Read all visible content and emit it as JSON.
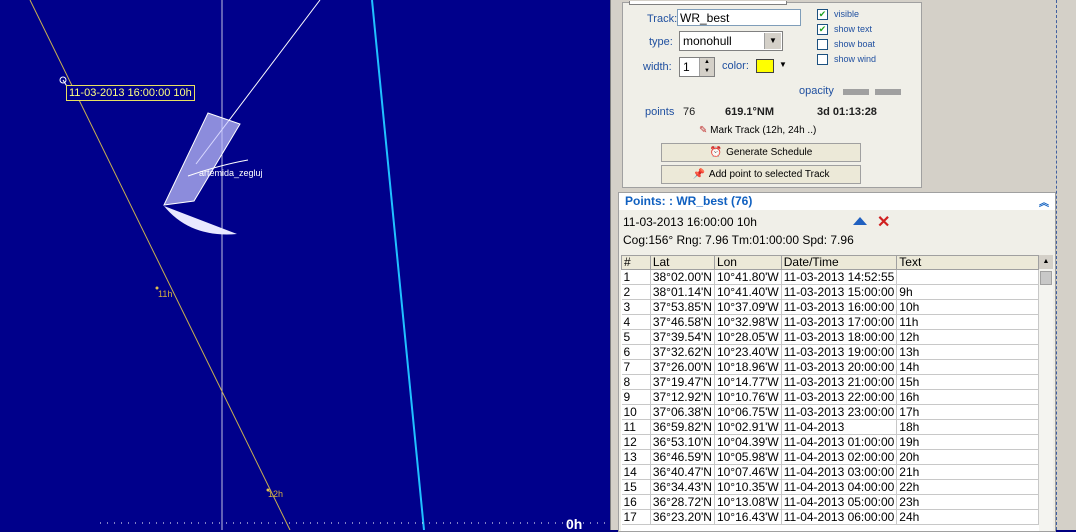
{
  "map": {
    "point_tag": "11-03-2013 16:00:00 10h",
    "boat_name": "artemida_zegluj",
    "hour_labels": [
      "11h",
      "12h"
    ],
    "zero_label": "0h",
    "colors": {
      "sea": "#00008b",
      "track_line": "#c8b050",
      "route_line": "#20c0ff"
    }
  },
  "track_props": {
    "track_label": "Track:",
    "track_value": "WR_best",
    "type_label": "type:",
    "type_value": "monohull",
    "width_label": "width:",
    "width_value": "1",
    "color_label": "color:",
    "color_value": "#ffff00",
    "checkboxes": [
      {
        "label": "visible",
        "checked": true
      },
      {
        "label": "show text",
        "checked": true
      },
      {
        "label": "show boat",
        "checked": false
      },
      {
        "label": "show wind",
        "checked": false
      }
    ],
    "opacity_label": "opacity",
    "points_label": "points",
    "points_value": "76",
    "distance": "619.1°NM",
    "duration": "3d 01:13:28",
    "mark_track_label": "Mark Track (12h, 24h ..)",
    "generate_schedule_label": "Generate Schedule",
    "add_point_label": "Add point to selected Track"
  },
  "points": {
    "header": "Points: : WR_best (76)",
    "selected_time": "11-03-2013 16:00:00 10h",
    "cog_line": "Cog:156° Rng:  7.96 Tm:01:00:00 Spd:  7.96",
    "columns": [
      "#",
      "Lat",
      "Lon",
      "Date/Time",
      "Text"
    ],
    "rows": [
      [
        "1",
        "38°02.00'N",
        "10°41.80'W",
        "11-03-2013 14:52:55",
        ""
      ],
      [
        "2",
        "38°01.14'N",
        "10°41.40'W",
        "11-03-2013 15:00:00",
        "9h"
      ],
      [
        "3",
        "37°53.85'N",
        "10°37.09'W",
        "11-03-2013 16:00:00",
        "10h"
      ],
      [
        "4",
        "37°46.58'N",
        "10°32.98'W",
        "11-03-2013 17:00:00",
        "11h"
      ],
      [
        "5",
        "37°39.54'N",
        "10°28.05'W",
        "11-03-2013 18:00:00",
        "12h"
      ],
      [
        "6",
        "37°32.62'N",
        "10°23.40'W",
        "11-03-2013 19:00:00",
        "13h"
      ],
      [
        "7",
        "37°26.00'N",
        "10°18.96'W",
        "11-03-2013 20:00:00",
        "14h"
      ],
      [
        "8",
        "37°19.47'N",
        "10°14.77'W",
        "11-03-2013 21:00:00",
        "15h"
      ],
      [
        "9",
        "37°12.92'N",
        "10°10.76'W",
        "11-03-2013 22:00:00",
        "16h"
      ],
      [
        "10",
        "37°06.38'N",
        "10°06.75'W",
        "11-03-2013 23:00:00",
        "17h"
      ],
      [
        "11",
        "36°59.82'N",
        "10°02.91'W",
        "11-04-2013",
        "18h"
      ],
      [
        "12",
        "36°53.10'N",
        "10°04.39'W",
        "11-04-2013 01:00:00",
        "19h"
      ],
      [
        "13",
        "36°46.59'N",
        "10°05.98'W",
        "11-04-2013 02:00:00",
        "20h"
      ],
      [
        "14",
        "36°40.47'N",
        "10°07.46'W",
        "11-04-2013 03:00:00",
        "21h"
      ],
      [
        "15",
        "36°34.43'N",
        "10°10.35'W",
        "11-04-2013 04:00:00",
        "22h"
      ],
      [
        "16",
        "36°28.72'N",
        "10°13.08'W",
        "11-04-2013 05:00:00",
        "23h"
      ],
      [
        "17",
        "36°23.20'N",
        "10°16.43'W",
        "11-04-2013 06:00:00",
        "24h"
      ]
    ]
  }
}
